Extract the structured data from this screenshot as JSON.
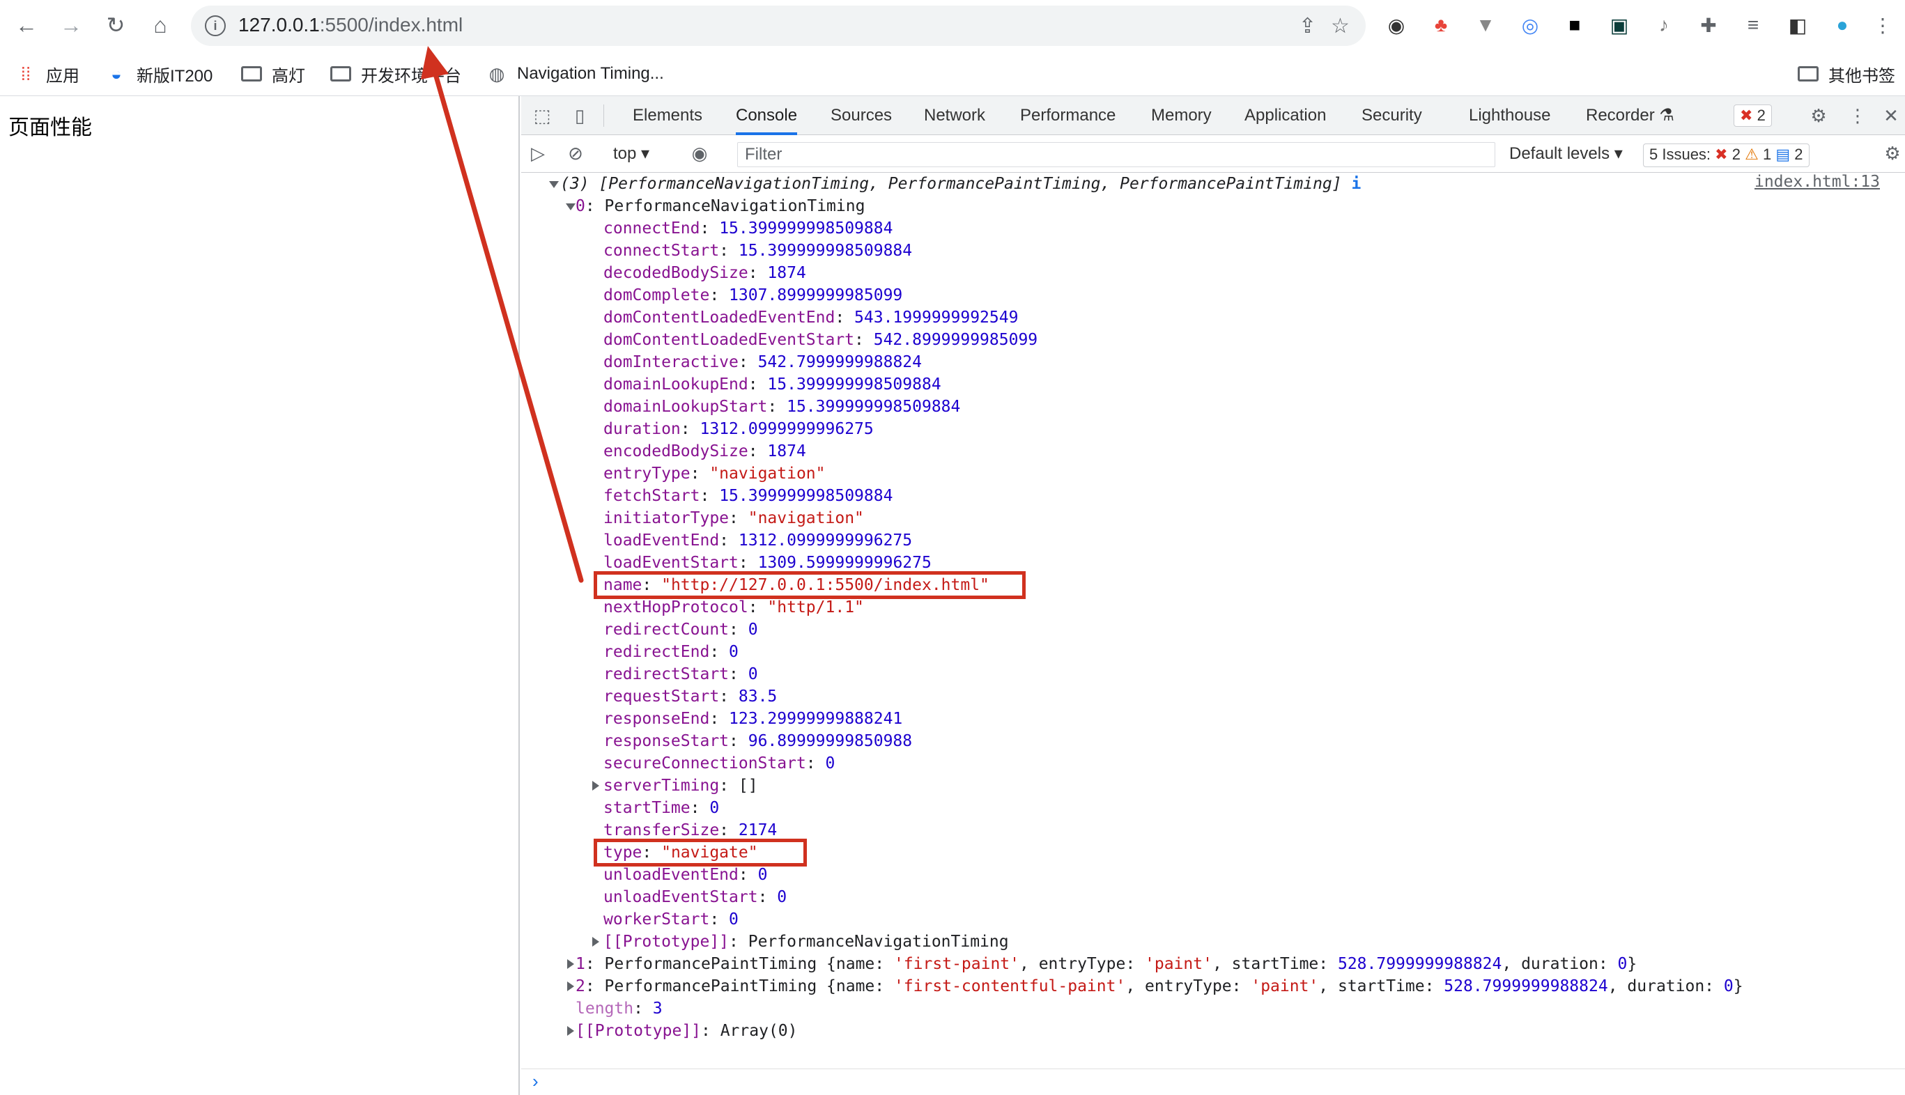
{
  "browser": {
    "url_host": "127.0.0.1",
    "url_rest": ":5500/index.html",
    "bookmarks": [
      "应用",
      "新版IT200",
      "高灯",
      "开发环境平台",
      "Navigation Timing...",
      "其他书签"
    ]
  },
  "page": {
    "heading": "页面性能"
  },
  "devtools": {
    "tabs": [
      "Elements",
      "Console",
      "Sources",
      "Network",
      "Performance",
      "Memory",
      "Application",
      "Security",
      "Lighthouse",
      "Recorder"
    ],
    "active_tab": "Console",
    "error_badge": "2",
    "context": "top",
    "filter_placeholder": "Filter",
    "levels": "Default levels",
    "issues_label": "5 Issues:",
    "issues_errors": "2",
    "issues_warnings": "1",
    "issues_info": "2",
    "source_link": "index.html:13"
  },
  "console": {
    "summary": "(3) [PerformanceNavigationTiming, PerformancePaintTiming, PerformancePaintTiming]",
    "item0_key": "0",
    "item0_type": "PerformanceNavigationTiming",
    "props": [
      {
        "k": "connectEnd",
        "v": "15.399999998509884",
        "t": "num"
      },
      {
        "k": "connectStart",
        "v": "15.399999998509884",
        "t": "num"
      },
      {
        "k": "decodedBodySize",
        "v": "1874",
        "t": "num"
      },
      {
        "k": "domComplete",
        "v": "1307.8999999985099",
        "t": "num"
      },
      {
        "k": "domContentLoadedEventEnd",
        "v": "543.1999999992549",
        "t": "num"
      },
      {
        "k": "domContentLoadedEventStart",
        "v": "542.8999999985099",
        "t": "num"
      },
      {
        "k": "domInteractive",
        "v": "542.7999999988824",
        "t": "num"
      },
      {
        "k": "domainLookupEnd",
        "v": "15.399999998509884",
        "t": "num"
      },
      {
        "k": "domainLookupStart",
        "v": "15.399999998509884",
        "t": "num"
      },
      {
        "k": "duration",
        "v": "1312.0999999996275",
        "t": "num"
      },
      {
        "k": "encodedBodySize",
        "v": "1874",
        "t": "num"
      },
      {
        "k": "entryType",
        "v": "\"navigation\"",
        "t": "str"
      },
      {
        "k": "fetchStart",
        "v": "15.399999998509884",
        "t": "num"
      },
      {
        "k": "initiatorType",
        "v": "\"navigation\"",
        "t": "str"
      },
      {
        "k": "loadEventEnd",
        "v": "1312.0999999996275",
        "t": "num"
      },
      {
        "k": "loadEventStart",
        "v": "1309.5999999996275",
        "t": "num"
      },
      {
        "k": "name",
        "v": "\"http://127.0.0.1:5500/index.html\"",
        "t": "str"
      },
      {
        "k": "nextHopProtocol",
        "v": "\"http/1.1\"",
        "t": "str"
      },
      {
        "k": "redirectCount",
        "v": "0",
        "t": "num"
      },
      {
        "k": "redirectEnd",
        "v": "0",
        "t": "num"
      },
      {
        "k": "redirectStart",
        "v": "0",
        "t": "num"
      },
      {
        "k": "requestStart",
        "v": "83.5",
        "t": "num"
      },
      {
        "k": "responseEnd",
        "v": "123.29999999888241",
        "t": "num"
      },
      {
        "k": "responseStart",
        "v": "96.89999999850988",
        "t": "num"
      },
      {
        "k": "secureConnectionStart",
        "v": "0",
        "t": "num"
      },
      {
        "k": "serverTiming",
        "v": "[]",
        "t": "plain",
        "expand": true
      },
      {
        "k": "startTime",
        "v": "0",
        "t": "num"
      },
      {
        "k": "transferSize",
        "v": "2174",
        "t": "num"
      },
      {
        "k": "type",
        "v": "\"navigate\"",
        "t": "str"
      },
      {
        "k": "unloadEventEnd",
        "v": "0",
        "t": "num"
      },
      {
        "k": "unloadEventStart",
        "v": "0",
        "t": "num"
      },
      {
        "k": "workerStart",
        "v": "0",
        "t": "num"
      },
      {
        "k": "[[Prototype]]",
        "v": "PerformanceNavigationTiming",
        "t": "plain",
        "expand": true
      }
    ],
    "item1": {
      "key": "1",
      "type": "PerformancePaintTiming",
      "name": "'first-paint'",
      "entryType": "'paint'",
      "startTime": "528.7999999988824",
      "duration": "0"
    },
    "item2": {
      "key": "2",
      "type": "PerformancePaintTiming",
      "name": "'first-contentful-paint'",
      "entryType": "'paint'",
      "startTime": "528.7999999988824",
      "duration": "0"
    },
    "length": "3",
    "array_proto": "Array(0)"
  },
  "annotation_color": "#d0311f"
}
